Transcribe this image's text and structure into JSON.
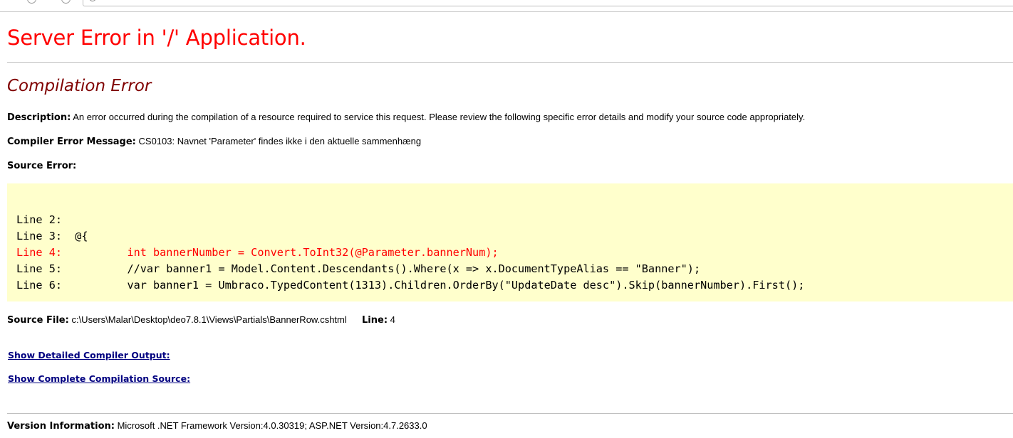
{
  "page": {
    "title": "Server Error in '/' Application.",
    "error_heading": "Compilation Error"
  },
  "description": {
    "label": "Description:",
    "text": "An error occurred during the compilation of a resource required to service this request. Please review the following specific error details and modify your source code appropriately."
  },
  "compiler_error": {
    "label": "Compiler Error Message:",
    "text": "CS0103: Navnet 'Parameter' findes ikke i den aktuelle sammenhæng"
  },
  "source_error": {
    "label": "Source Error:",
    "lines": [
      "Line 2:  ",
      "Line 3:  @{",
      "Line 4:          int bannerNumber = Convert.ToInt32(@Parameter.bannerNum);",
      "Line 5:          //var banner1 = Model.Content.Descendants().Where(x => x.DocumentTypeAlias == \"Banner\");",
      "Line 6:          var banner1 = Umbraco.TypedContent(1313).Children.OrderBy(\"UpdateDate desc\").Skip(bannerNumber).First();"
    ],
    "error_line_index": 2
  },
  "source_file": {
    "label": "Source File:",
    "path": "c:\\Users\\Malar\\Desktop\\deo7.8.1\\Views\\Partials\\BannerRow.cshtml",
    "line_label": "Line:",
    "line_value": "4"
  },
  "links": {
    "detailed_output": "Show Detailed Compiler Output:",
    "complete_source": "Show Complete Compilation Source:"
  },
  "version": {
    "label": "Version Information:",
    "text": "Microsoft .NET Framework Version:4.0.30319; ASP.NET Version:4.7.2633.0"
  },
  "colors": {
    "title": "#ff0000",
    "heading": "#800000",
    "code_background": "#ffffcc",
    "error_line": "#ff0000",
    "link": "#000080"
  }
}
